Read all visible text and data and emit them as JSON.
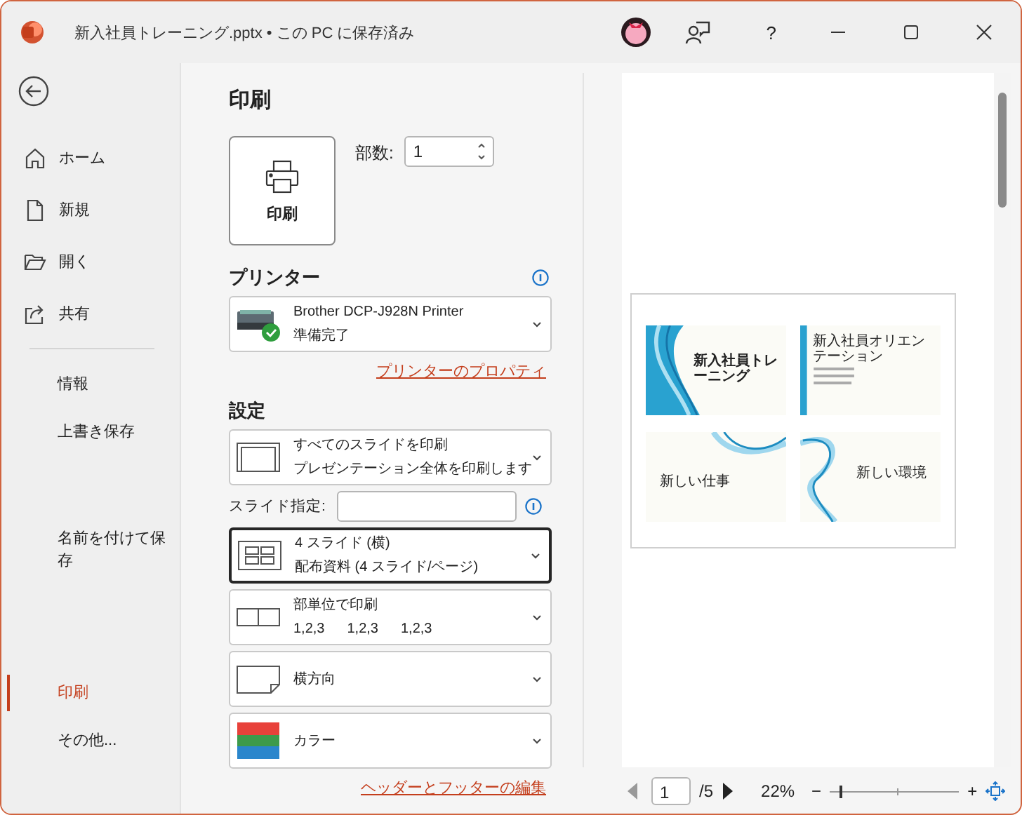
{
  "window": {
    "title": "新入社員トレーニング.pptx • この PC に保存済み",
    "help": "?"
  },
  "sidebar": {
    "nav": [
      {
        "label": "ホーム"
      },
      {
        "label": "新規"
      },
      {
        "label": "開く"
      },
      {
        "label": "共有"
      }
    ],
    "items": [
      {
        "label": "情報",
        "selected": false
      },
      {
        "label": "上書き保存",
        "selected": false
      },
      {
        "label": "名前を付けて保存",
        "selected": false
      },
      {
        "label": "印刷",
        "selected": true
      },
      {
        "label": "その他...",
        "selected": false
      }
    ]
  },
  "print": {
    "heading": "印刷",
    "button": "印刷",
    "copies": {
      "label": "部数:",
      "value": "1"
    }
  },
  "printer": {
    "heading": "プリンター",
    "name": "Brother DCP-J928N Printer",
    "status": "準備完了",
    "link": "プリンターのプロパティ"
  },
  "settings": {
    "heading": "設定",
    "items": [
      {
        "kind": "slides",
        "title": "すべてのスライドを印刷",
        "subtitle": "プレゼンテーション全体を印刷します",
        "focused": false
      },
      {
        "kind": "range",
        "label": "スライド指定:"
      },
      {
        "kind": "layout",
        "title": "4 スライド (横)",
        "subtitle": "配布資料 (4 スライド/ページ)",
        "focused": true
      },
      {
        "kind": "collate",
        "title": "部単位で印刷",
        "pages": [
          "1,2,3",
          "1,2,3",
          "1,2,3"
        ],
        "focused": false
      },
      {
        "kind": "orientation",
        "title": "横方向",
        "focused": false
      },
      {
        "kind": "color",
        "title": "カラー",
        "focused": false
      }
    ],
    "link": "ヘッダーとフッターの編集"
  },
  "preview": {
    "slides": [
      {
        "kind": "cover",
        "title": "新入社員トレーニング"
      },
      {
        "kind": "list",
        "title": "新入社員オリエンテーション"
      },
      {
        "kind": "wave_top",
        "title": "新しい仕事"
      },
      {
        "kind": "wave_left",
        "title": "新しい環境"
      }
    ],
    "page": "1",
    "total": "/5",
    "zoom": "22%",
    "zoom_slider": {
      "level": 0.08
    },
    "zoom_out": "−",
    "zoom_in": "+"
  }
}
